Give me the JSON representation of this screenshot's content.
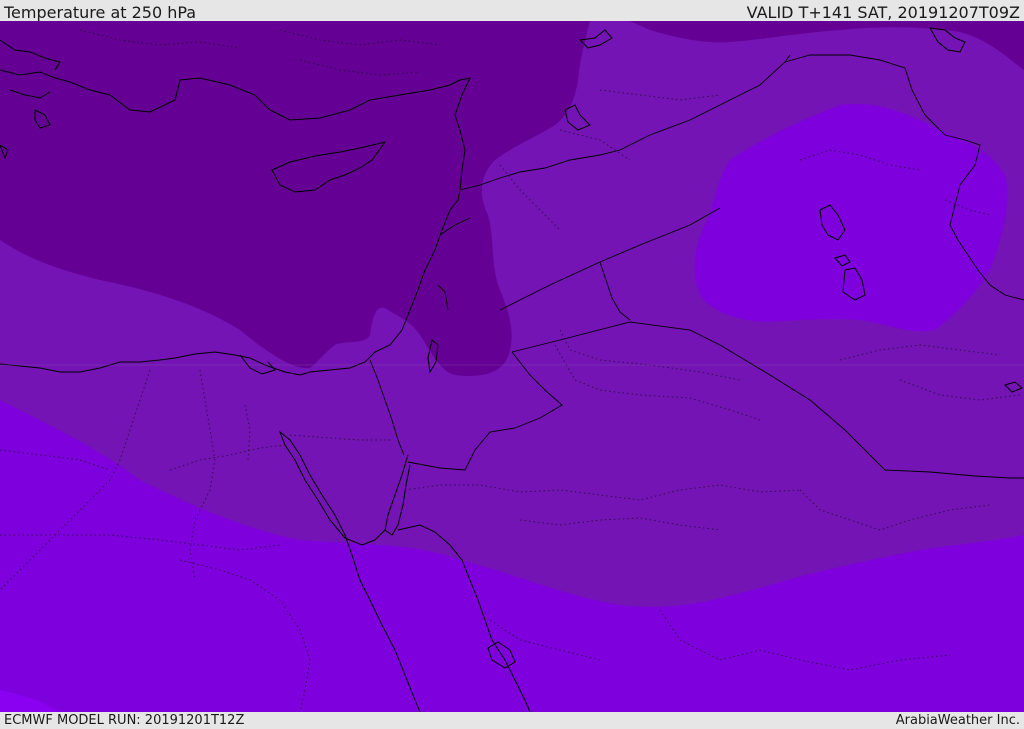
{
  "header": {
    "title": "Temperature at 250 hPa",
    "valid": "VALID T+141 SAT, 20191207T09Z"
  },
  "footer": {
    "model_run": "ECMWF MODEL RUN: 20191201T12Z",
    "credit": "ArabiaWeather Inc."
  },
  "colors": {
    "band_darkest": "#650094",
    "band_dark": "#7210b0",
    "band_mid": "#7a14c4",
    "band_bright": "#7e00dc",
    "band_brightest": "#8a00f0"
  }
}
